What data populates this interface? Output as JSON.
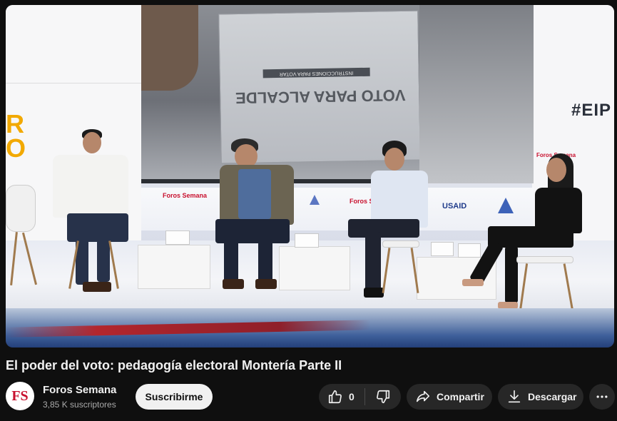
{
  "video": {
    "title": "El poder del voto: pedagogía electoral Montería Parte II",
    "scene": {
      "screen_ballot_text": "VOTO PARA ALCALDE",
      "screen_ballot_instructions": "INSTRUCCIONES PARA VOTAR",
      "hashtag": "#EIP",
      "side_letters": [
        "R",
        "O"
      ],
      "banner_logos": [
        "Foros Semana",
        "Foros Semana",
        "USAID",
        "Foros Sema"
      ],
      "side_logo_right": "Foros Semana"
    }
  },
  "channel": {
    "avatar_text": "FS",
    "name": "Foros Semana",
    "subscribers": "3,85 K suscriptores",
    "subscribe_label": "Suscribirme"
  },
  "actions": {
    "like_count": "0",
    "share_label": "Compartir",
    "download_label": "Descargar"
  },
  "icons": {
    "like": "thumbs-up-icon",
    "dislike": "thumbs-down-icon",
    "share": "share-arrow-icon",
    "download": "download-icon",
    "more": "more-horizontal-icon"
  },
  "colors": {
    "page_bg": "#0f0f0f",
    "pill_bg": "#272727",
    "subscribe_bg": "#f1f1f1",
    "text_primary": "#f1f1f1",
    "text_secondary": "#aaaaaa",
    "brand_red": "#c8102e"
  }
}
